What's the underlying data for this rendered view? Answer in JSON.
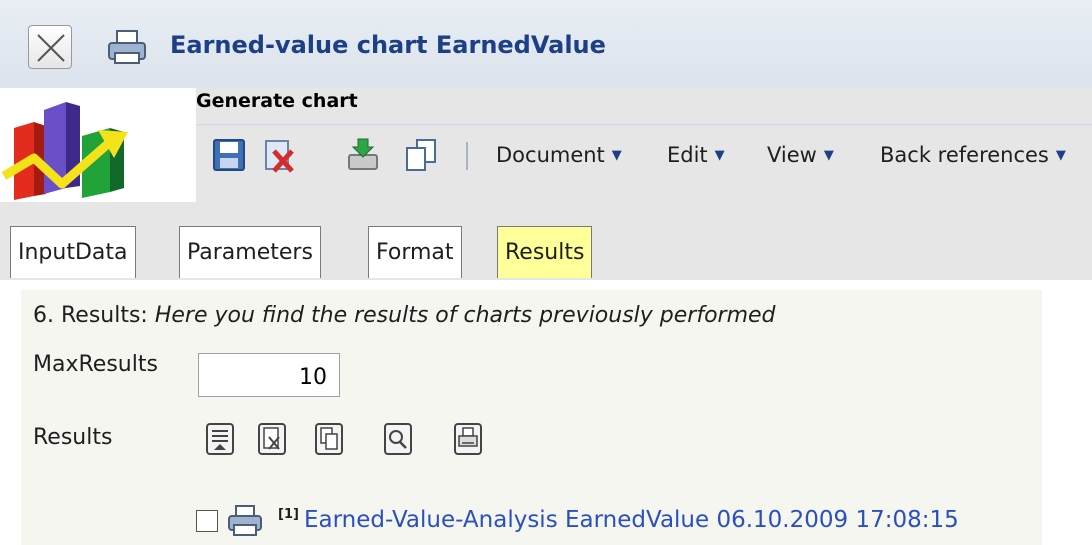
{
  "window": {
    "title": "Earned-value chart EarnedValue"
  },
  "header": {
    "section_title": "Generate chart",
    "menus": [
      {
        "label": "Document",
        "caret": "▼"
      },
      {
        "label": "Edit",
        "caret": "▼"
      },
      {
        "label": "View",
        "caret": "▼"
      },
      {
        "label": "Back references",
        "caret": "▼"
      }
    ],
    "toolbar_icons": [
      "save-icon",
      "delete-icon",
      "export-icon",
      "copy-icon"
    ]
  },
  "tabs": [
    {
      "label": "InputData",
      "active": false
    },
    {
      "label": "Parameters",
      "active": false
    },
    {
      "label": "Format",
      "active": false
    },
    {
      "label": "Results",
      "active": true
    }
  ],
  "results_panel": {
    "heading_prefix": "6. Results: ",
    "heading_italic": "Here you find the results of charts previously performed",
    "max_results_label": "MaxResults",
    "max_results_value": "10",
    "results_label": "Results",
    "result_toolbar_icons": [
      "list-icon",
      "remove-icon",
      "copy-icon",
      "search-icon",
      "print-icon"
    ],
    "items": [
      {
        "footnote": "[1]",
        "link_text": "Earned-Value-Analysis EarnedValue 06.10.2009 17:08:15",
        "checked": false
      }
    ]
  },
  "colors": {
    "title_text": "#1c3f86",
    "active_tab": "#ffff99",
    "link": "#2a4fbf",
    "header_gray": "#e6e6e6",
    "panel_bg": "#f6f6f0"
  }
}
